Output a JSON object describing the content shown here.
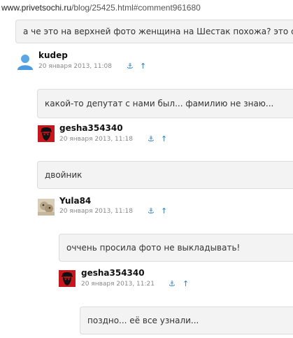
{
  "url": {
    "host": "www.privetsochi.ru",
    "path": "/blog/25425.html#comment961680"
  },
  "comments": [
    {
      "text": "а че это на верхней фото женщина на Шестак похожа? это она?",
      "author": "kudep",
      "date": "20 января 2013, 11:08",
      "avatar": "default-user-icon"
    },
    {
      "text": "какой-то депутат с нами был... фамилию не знаю...",
      "author": "gesha354340",
      "date": "20 января 2013, 11:18",
      "avatar": "che-portrait-avatar"
    },
    {
      "text": "двойник",
      "author": "Yula84",
      "date": "20 января 2013, 11:18",
      "avatar": "photo-avatar"
    },
    {
      "text": "оччень просила фото не выкладывать!",
      "author": "gesha354340",
      "date": "20 января 2013, 11:21",
      "avatar": "che-portrait-avatar"
    },
    {
      "text": "поздно... её все узнали..."
    }
  ],
  "actions": {
    "anchor_icon": "⚓",
    "up_icon": "↑"
  },
  "colors": {
    "bubble_bg": "#f3f3f3",
    "link": "#2a7fc4"
  }
}
